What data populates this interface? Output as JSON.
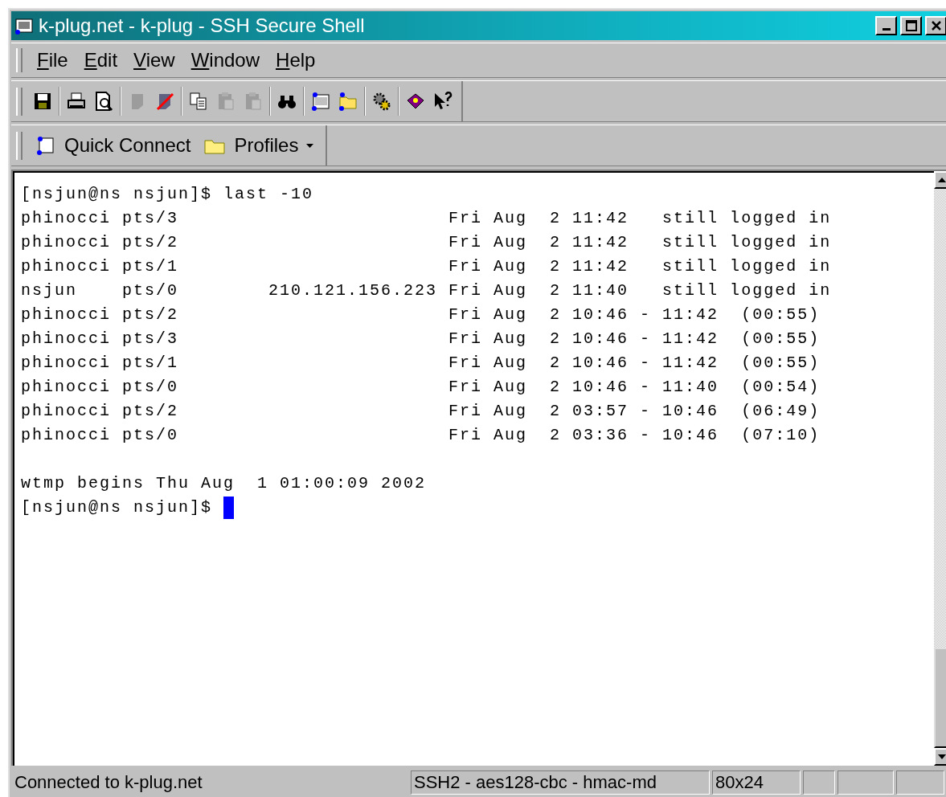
{
  "window": {
    "title": "k-plug.net - k-plug - SSH Secure Shell"
  },
  "menu": [
    "File",
    "Edit",
    "View",
    "Window",
    "Help"
  ],
  "toolbar": [
    {
      "kind": "save",
      "disabled": false
    },
    {
      "kind": "separator"
    },
    {
      "kind": "print",
      "disabled": false
    },
    {
      "kind": "preview",
      "disabled": false
    },
    {
      "kind": "separator"
    },
    {
      "kind": "connect",
      "disabled": true
    },
    {
      "kind": "disconnect",
      "disabled": false
    },
    {
      "kind": "separator"
    },
    {
      "kind": "copy",
      "disabled": false
    },
    {
      "kind": "paste",
      "disabled": true
    },
    {
      "kind": "paste",
      "disabled": true
    },
    {
      "kind": "separator"
    },
    {
      "kind": "find",
      "disabled": false
    },
    {
      "kind": "separator"
    },
    {
      "kind": "terminal",
      "disabled": false
    },
    {
      "kind": "transfer",
      "disabled": false
    },
    {
      "kind": "separator"
    },
    {
      "kind": "settings",
      "disabled": false
    },
    {
      "kind": "separator"
    },
    {
      "kind": "help",
      "disabled": false
    },
    {
      "kind": "whatsthis",
      "disabled": false
    }
  ],
  "connect_bar": {
    "quick_connect": "Quick Connect",
    "profiles": "Profiles"
  },
  "terminal": {
    "blocks": [
      [
        "[nsjun@ns nsjun]$ last -10",
        "phinocci pts/3                        Fri Aug  2 11:42   still logged in",
        "phinocci pts/2                        Fri Aug  2 11:42   still logged in",
        "phinocci pts/1                        Fri Aug  2 11:42   still logged in",
        "nsjun    pts/0        210.121.156.223 Fri Aug  2 11:40   still logged in",
        "phinocci pts/2                        Fri Aug  2 10:46 - 11:42  (00:55)",
        "phinocci pts/3                        Fri Aug  2 10:46 - 11:42  (00:55)",
        "phinocci pts/1                        Fri Aug  2 10:46 - 11:42  (00:55)",
        "phinocci pts/0                        Fri Aug  2 10:46 - 11:40  (00:54)",
        "phinocci pts/2                        Fri Aug  2 03:57 - 10:46  (06:49)",
        "phinocci pts/0                        Fri Aug  2 03:36 - 10:46  (07:10)"
      ],
      [
        "wtmp begins Thu Aug  1 01:00:09 2002",
        "[nsjun@ns nsjun]$ "
      ]
    ],
    "cursor": true
  },
  "status_bar": {
    "message": "Connected to k-plug.net",
    "cipher": "SSH2 - aes128-cbc - hmac-md",
    "size": "80x24"
  }
}
